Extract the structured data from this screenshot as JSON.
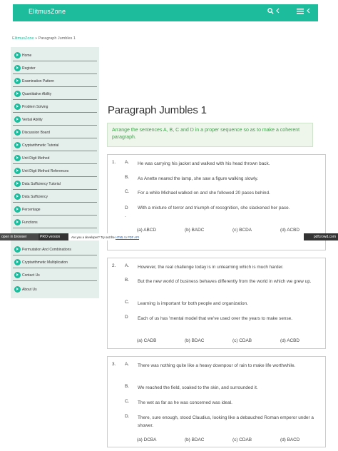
{
  "header": {
    "brand": "ElitmusZone",
    "search_icon": "search-icon",
    "menu_icon": "menu-icon"
  },
  "breadcrumb": {
    "home": "ElitmusZone",
    "sep": " » ",
    "current": "Paragraph Jumbles 1"
  },
  "sidebar": {
    "items": [
      "Home",
      "Register",
      "Examination Pattern",
      "Quantitative Ability",
      "Problem Solving",
      "Verbal Ability",
      "Discussion Board",
      "Cryptarithmetic Tutorial",
      "Unit Digit Method",
      "Unit Digit Method References",
      "Data Sufficiency Tutorial",
      "Data Sufficiency",
      "Percentage",
      "Functions",
      "Permutation And Combinations",
      "Cryptarithmetic Multiplication",
      "Contact Us",
      "About Us"
    ]
  },
  "pdf_banner": {
    "open_label": "open in browser",
    "pro_label": "PRO version",
    "msg_prefix": "Are you a developer? Try out the ",
    "msg_link": "HTML to PDF API",
    "site": "pdfcrowd.com"
  },
  "page": {
    "title": "Paragraph Jumbles 1",
    "instruction": "Arrange the sentences A, B, C and D in a proper sequence so as to make a coherent paragraph."
  },
  "questions": [
    {
      "number": "1.",
      "options": [
        {
          "letter": "A.",
          "text": "He was carrying his jacket and walked with his head thrown back."
        },
        {
          "letter": "B.",
          "text": "As Anette neared the lamp, she saw a figure walking slowly."
        },
        {
          "letter": "C.",
          "text": "For a while Michael walked on and she followed 20 paces behind."
        },
        {
          "letter": "D\n.",
          "text": "With a mixture of terror and triumph of recognition, she slackened her pace."
        }
      ],
      "answers": [
        "(a) ABCD",
        "(b) BADC",
        "(c) BCDA",
        "(d) ACBD"
      ]
    },
    {
      "number": "2.",
      "options": [
        {
          "letter": "A.",
          "text": "However, the real challenge today is in unlearning which is much harder."
        },
        {
          "letter": "B.",
          "text": "But the new world of business behaves differently from the world in which we grew up."
        },
        {
          "letter": "C.",
          "text": "Learning is important for both people and organization."
        },
        {
          "letter": "D",
          "text": "Each of us has 'mental model that we've used over the years to make sense."
        }
      ],
      "answers": [
        "(a) CADB",
        "(b) BDAC",
        "(c) CDAB",
        "(d) ACBD"
      ]
    },
    {
      "number": "3.",
      "options": [
        {
          "letter": "A.",
          "text": "There was nothing quite like a heavy downpour of rain to make life worthwhile."
        },
        {
          "letter": "B.",
          "text": "We reached the field, soaked to the skin, and surrounded it."
        },
        {
          "letter": "C.",
          "text": "The wet as far as he was concerned was ideal."
        },
        {
          "letter": "D.",
          "text": "There, sure enough, stood Claudius, looking like a debauched Roman emperor under a shower."
        }
      ],
      "answers": [
        "(a) DCBA",
        "(b) BDAC",
        "(c) CDAB",
        "(d) BACD"
      ]
    }
  ]
}
